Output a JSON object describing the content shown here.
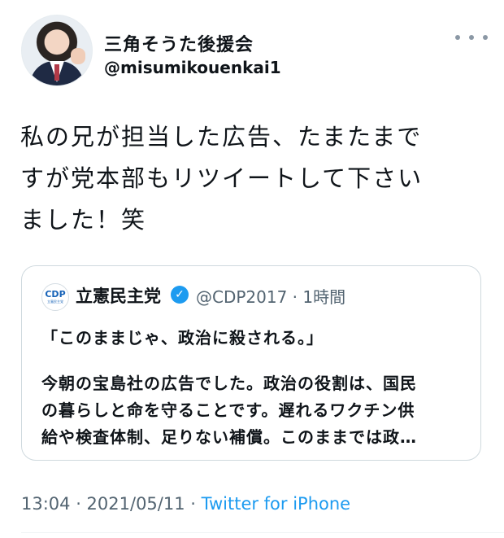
{
  "author": {
    "name": "三角そうた後援会",
    "handle": "@misumikouenkai1"
  },
  "tweet": {
    "text_line1": "私の兄が担当した広告、たまたまで",
    "text_line2": "すが党本部もリツイートして下さい",
    "text_line3": "ました！笑"
  },
  "quoted": {
    "logo_text": "CDP",
    "logo_sub": "立憲民主党",
    "name": "立憲民主党",
    "verified_glyph": "✓",
    "handle_time": "@CDP2017 · 1時間",
    "title": "「このままじゃ、政治に殺される。」",
    "body_line1": "今朝の宝島社の広告でした。政治の役割は、国民",
    "body_line2": "の暮らしと命を守ることです。遅れるワクチン供",
    "body_line3": "給や検査体制、足りない補償。このままでは政…"
  },
  "meta": {
    "time_date": "13:04 · 2021/05/11 · ",
    "source": "Twitter for iPhone"
  },
  "colors": {
    "text": "#0f1419",
    "secondary": "#536471",
    "accent": "#1d9bf0",
    "border": "#cfd9de"
  },
  "icons": {
    "more": "more-horizontal-icon",
    "verified": "verified-badge-icon"
  }
}
